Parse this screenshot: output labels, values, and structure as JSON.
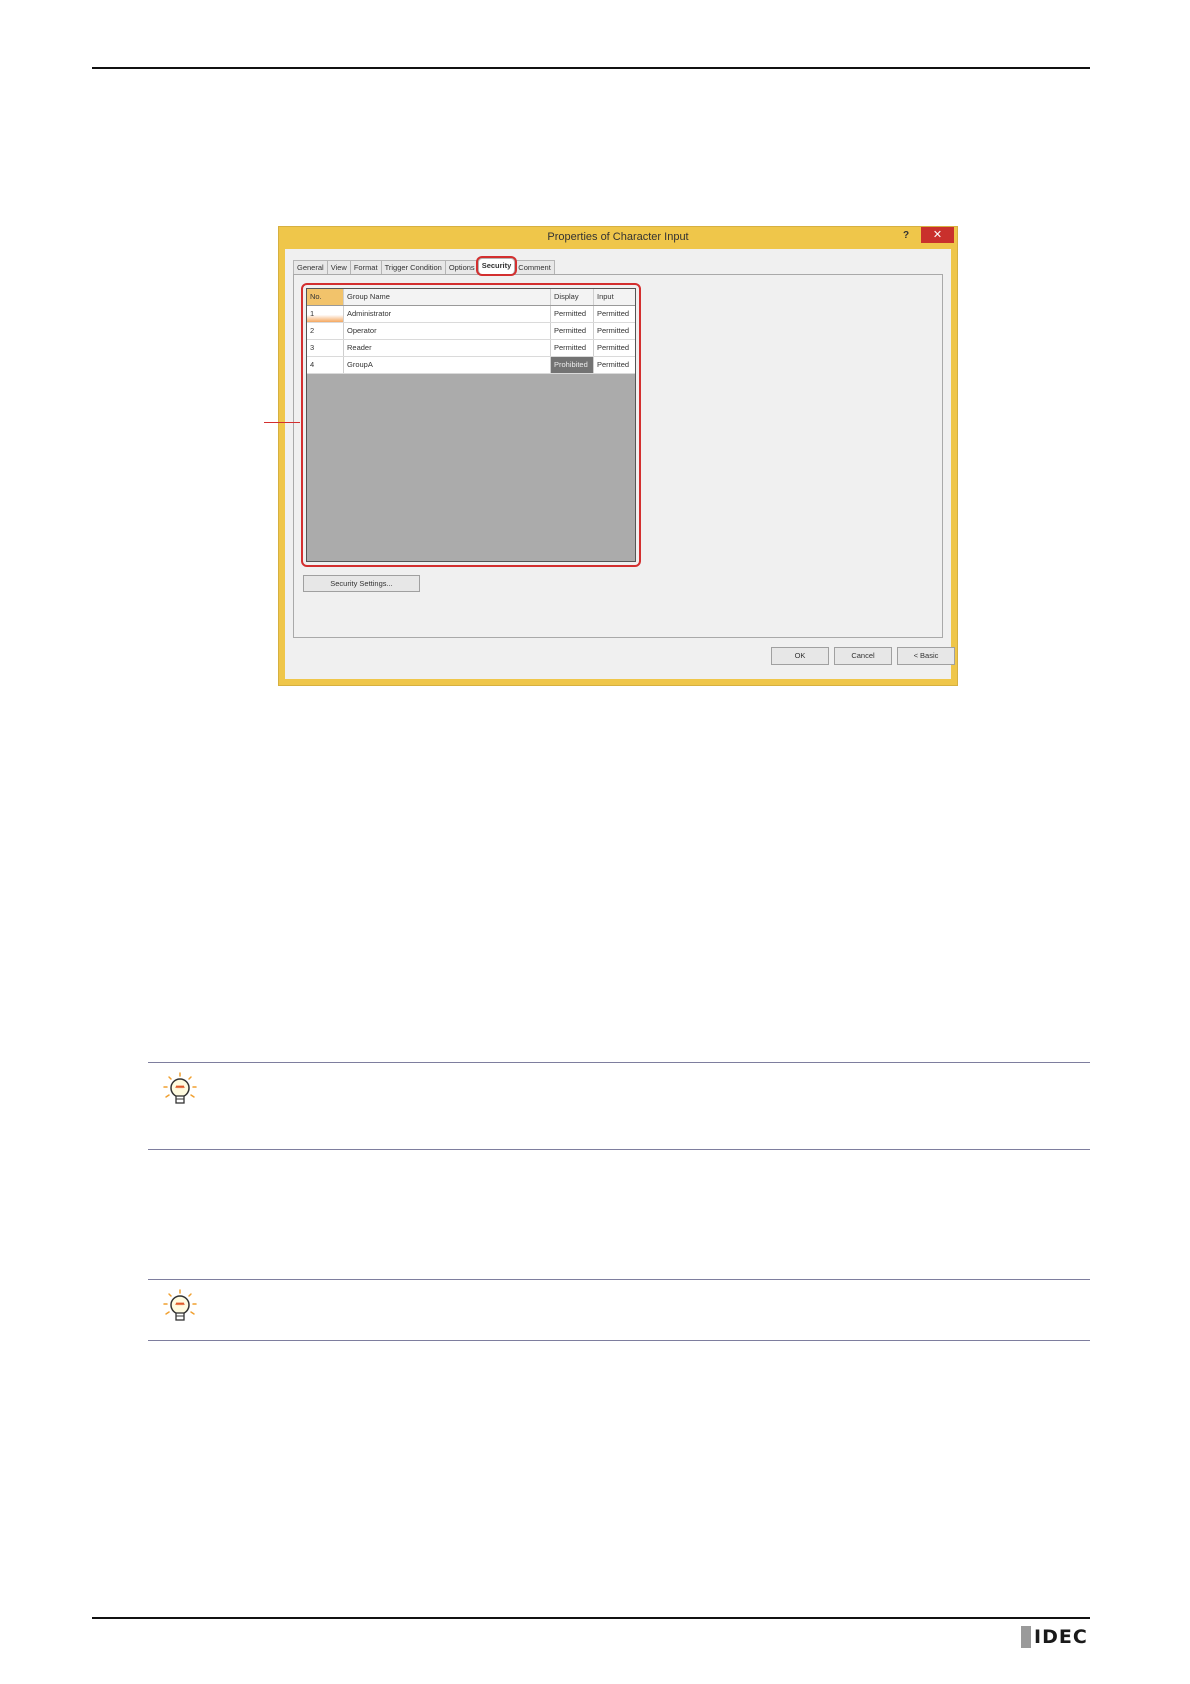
{
  "dialog": {
    "title": "Properties of Character Input",
    "help_label": "?",
    "close_label": "✕",
    "tabs": [
      {
        "label": "General"
      },
      {
        "label": "View"
      },
      {
        "label": "Format"
      },
      {
        "label": "Trigger Condition"
      },
      {
        "label": "Options"
      },
      {
        "label": "Security",
        "active": true
      },
      {
        "label": "Comment"
      }
    ],
    "grid": {
      "columns": [
        "No.",
        "Group Name",
        "Display",
        "Input"
      ],
      "rows": [
        {
          "no": "1",
          "name": "Administrator",
          "display": "Permitted",
          "input": "Permitted"
        },
        {
          "no": "2",
          "name": "Operator",
          "display": "Permitted",
          "input": "Permitted"
        },
        {
          "no": "3",
          "name": "Reader",
          "display": "Permitted",
          "input": "Permitted"
        },
        {
          "no": "4",
          "name": "GroupA",
          "display": "Prohibited",
          "input": "Permitted"
        }
      ]
    },
    "security_settings_label": "Security Settings...",
    "ok_label": "OK",
    "cancel_label": "Cancel",
    "basic_label": "< Basic"
  },
  "footer": {
    "logo_text": "IDEC"
  },
  "colors": {
    "dialog_frame": "#efc64a",
    "highlight": "#d32f2f",
    "prohibited": "#737373",
    "tip_rule": "#7e7e9e"
  },
  "icons": [
    "lightbulb-tip-icon"
  ]
}
